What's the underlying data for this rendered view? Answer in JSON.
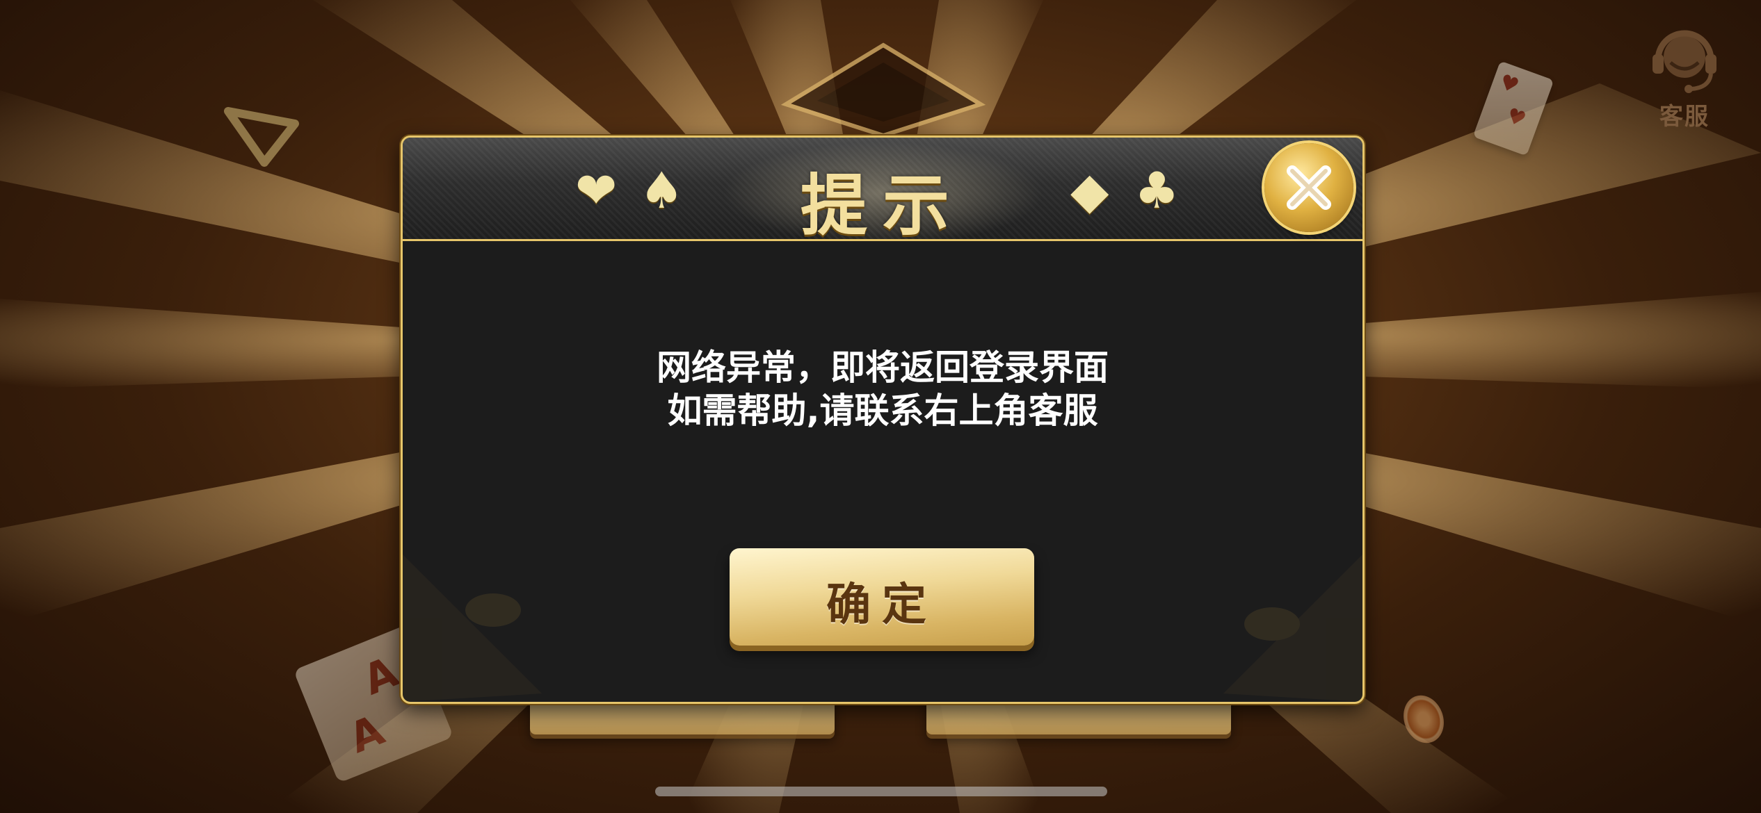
{
  "dialog": {
    "title": "提示",
    "header_suits_left": [
      "❤",
      "♠"
    ],
    "header_suits_right": [
      "◆",
      "♣"
    ],
    "message_line1": "网络异常，即将返回登录界面",
    "message_line2": "如需帮助,请联系右上角客服",
    "confirm_label": "确定"
  },
  "support": {
    "label": "客服",
    "icon": "headset-icon"
  },
  "colors": {
    "gold": "#e6c56a",
    "title_text": "#f3df9e",
    "dialog_body": "#1c1c1c",
    "confirm_text": "#5a3510",
    "background": "#3a1f0b"
  }
}
